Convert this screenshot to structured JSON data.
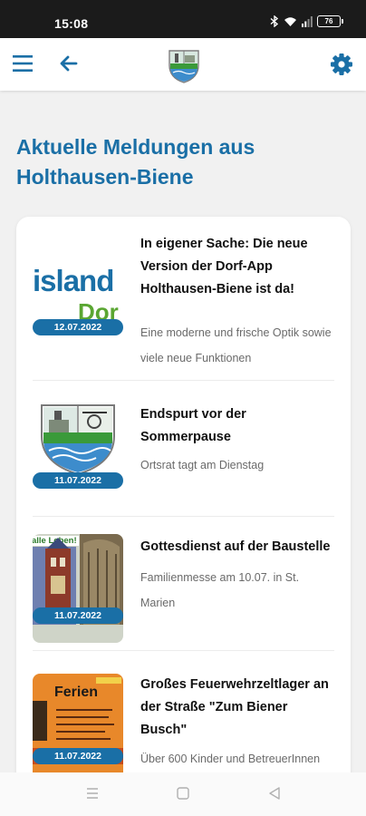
{
  "status_bar": {
    "time": "15:08",
    "battery": "76",
    "icons": [
      "bluetooth-icon",
      "wifi-icon",
      "signal-icon",
      "battery-icon"
    ]
  },
  "app_bar": {
    "icons": [
      "menu-icon",
      "back-arrow-icon",
      "village-crest-logo",
      "gear-icon"
    ],
    "accent_color": "#1a6fa6"
  },
  "page": {
    "heading": "Aktuelle Meldungen aus Holthausen-Biene"
  },
  "news": [
    {
      "date": "12.07.2022",
      "title": "In eigener Sache: Die neue Version der Dorf-App Holthausen-Biene ist da!",
      "desc": "Eine moderne und frische Optik sowie viele neue Funktionen",
      "thumb_text_1": "island",
      "thumb_text_2": "Dor"
    },
    {
      "date": "11.07.2022",
      "title": "Endspurt vor der Sommerpause",
      "desc": "Ortsrat tagt am Dienstag"
    },
    {
      "date": "11.07.2022",
      "title": "Gottesdienst auf der Baustelle",
      "desc": "Familienmesse am 10.07. in St. Marien",
      "thumb_text": "alle Leben!"
    },
    {
      "date": "11.07.2022",
      "title": "Großes Feuerwehrzeltlager an der Straße \"Zum Biener Busch\"",
      "desc": "Über 600 Kinder und BetreuerInnen",
      "thumb_text": "Ferien"
    }
  ],
  "nav_bar": {
    "icons": [
      "recent-apps-icon",
      "home-icon",
      "back-icon"
    ]
  }
}
